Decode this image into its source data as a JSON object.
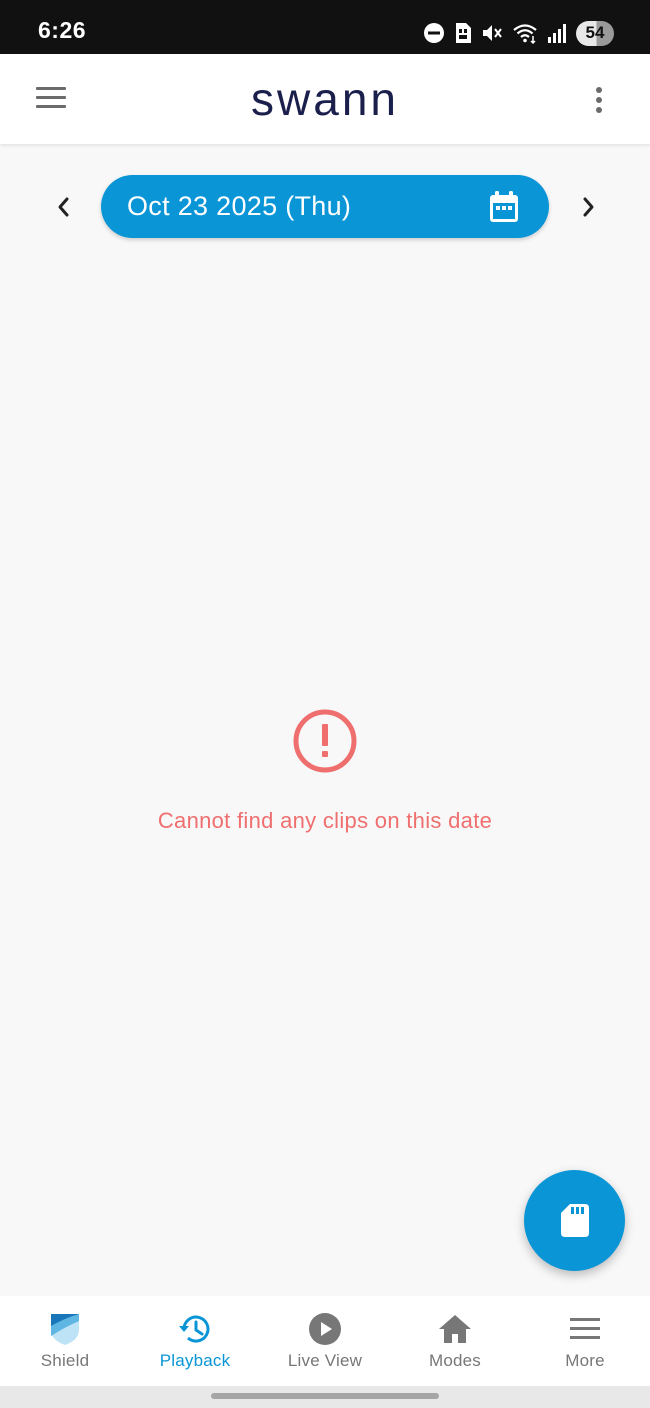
{
  "status_bar": {
    "time": "6:26",
    "battery": "54",
    "icons": [
      "do-not-disturb-icon",
      "sim-icon",
      "mute-icon",
      "wifi-icon",
      "signal-icon",
      "battery-icon"
    ]
  },
  "app_bar": {
    "logo": "swann",
    "left_icon": "hamburger-menu-icon",
    "right_icon": "more-vertical-icon"
  },
  "date_selector": {
    "date": "Oct 23 2025 (Thu)",
    "prev_icon": "chevron-left-icon",
    "next_icon": "chevron-right-icon",
    "calendar_icon": "calendar-icon"
  },
  "empty_state": {
    "icon": "error-circle-icon",
    "message": "Cannot find any clips on this date",
    "color": "#ef6f6f"
  },
  "fab": {
    "icon": "sd-card-icon"
  },
  "bottom_nav": {
    "active_index": 1,
    "items": [
      {
        "label": "Shield",
        "icon": "shield-icon"
      },
      {
        "label": "Playback",
        "icon": "history-icon"
      },
      {
        "label": "Live View",
        "icon": "play-circle-icon"
      },
      {
        "label": "Modes",
        "icon": "home-icon"
      },
      {
        "label": "More",
        "icon": "menu-icon"
      }
    ]
  },
  "colors": {
    "accent": "#0a95d6",
    "logo": "#1b1f4b",
    "error": "#ef6f6f",
    "inactive": "#777777",
    "background": "#f8f8f9"
  }
}
